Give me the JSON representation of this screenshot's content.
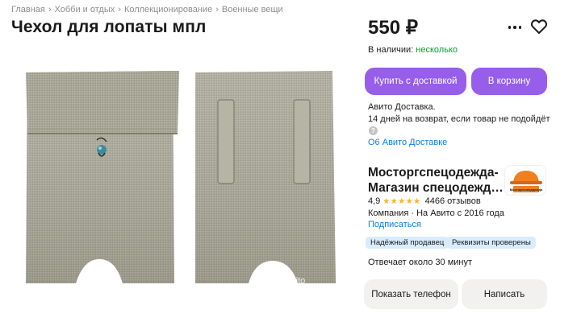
{
  "breadcrumb": [
    "Главная",
    "Хобби и отдых",
    "Коллекционирование",
    "Военные вещи"
  ],
  "title": "Чехол для лопаты мпл",
  "image": {
    "watermark": "Avito"
  },
  "price": "550 ₽",
  "actions": {
    "more_icon": "more-horizontal-icon",
    "favorite_icon": "heart-icon"
  },
  "availability": {
    "label": "В наличии:",
    "value": "несколько"
  },
  "buttons": {
    "buy_delivery": "Купить с доставкой",
    "add_cart": "В корзину",
    "show_phone": "Показать телефон",
    "write": "Написать"
  },
  "delivery": {
    "line1": "Авито Доставка.",
    "line2": "14 дней на возврат, если товар не подойдёт",
    "help_icon": "?",
    "link": "О6 Авито Доставке"
  },
  "seller": {
    "name_line1": "Мосторгспецодежда-",
    "name_line2": "Магазин спецодежда...",
    "logo_text": "Мосторгспецодежда",
    "rating": "4,9",
    "stars": "★★★★★",
    "reviews": "4466 отзывов",
    "company": "Компания · На Авито с 2016 года",
    "subscribe": "Подписаться",
    "badges": [
      "Надёжный продавец",
      "Реквизиты проверены"
    ],
    "response_time": "Отвечает около 30 минут"
  },
  "colors": {
    "accent": "#965eeb",
    "link": "#0a7ee2",
    "green": "#02a22e",
    "badge_bg": "#d9ecfe"
  }
}
